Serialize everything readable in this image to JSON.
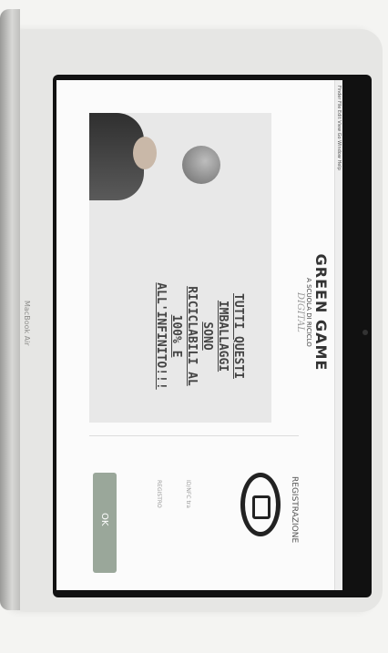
{
  "device": {
    "model_label": "MacBook Air"
  },
  "menubar": {
    "items": "Finder  File  Edit  View  Go  Window  Help"
  },
  "promo": {
    "headline_lines": [
      "TUTTI QUESTI",
      "IMBALLAGGI",
      "SONO",
      "RICICLABILI AL",
      "100% E",
      "ALL'INFINITO!!!"
    ]
  },
  "logo": {
    "title": "GREEN GAME",
    "subtitle": "A SCUOLA DI RICICLO",
    "tagline": "DIGITAL"
  },
  "registration": {
    "title": "REGISTRAZIONE",
    "field_1_label": "ID/NFC tra",
    "field_2_label": "REGISTRO",
    "ok_label": "OK"
  },
  "colors": {
    "button": "#9aa79a",
    "bezel": "#111111"
  }
}
